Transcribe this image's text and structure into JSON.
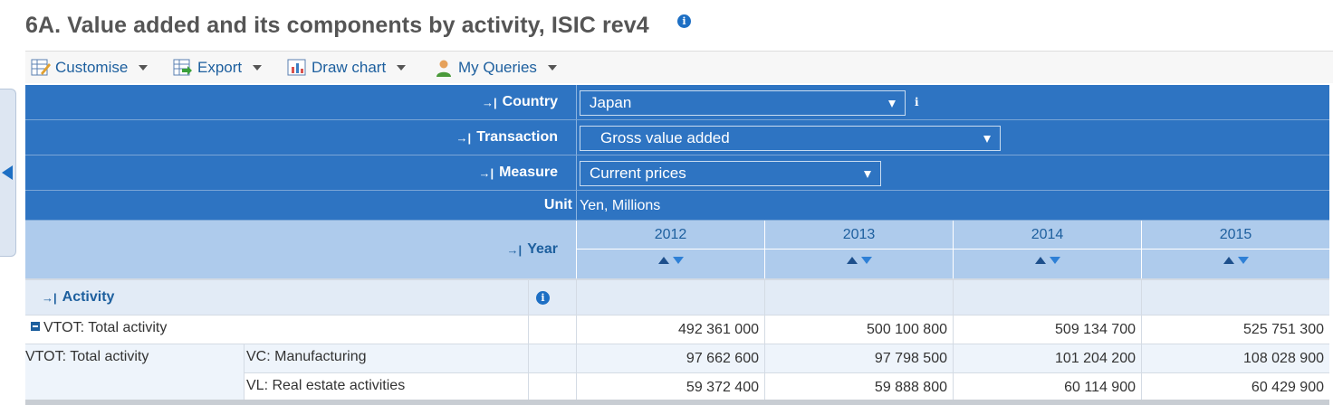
{
  "header": {
    "title": "6A. Value added and its components by activity, ISIC rev4",
    "info_icon": "info-icon"
  },
  "toolbar": {
    "items": [
      {
        "label": "Customise",
        "icon": "customise-icon"
      },
      {
        "label": "Export",
        "icon": "export-icon"
      },
      {
        "label": "Draw chart",
        "icon": "chart-icon"
      },
      {
        "label": "My Queries",
        "icon": "user-icon"
      }
    ]
  },
  "filters": {
    "country": {
      "label": "Country",
      "value": "Japan"
    },
    "transaction": {
      "label": "Transaction",
      "value": "Gross value added"
    },
    "measure": {
      "label": "Measure",
      "value": "Current prices"
    },
    "unit": {
      "label": "Unit",
      "value": "Yen, Millions"
    }
  },
  "year_header": {
    "label": "Year",
    "years": [
      "2012",
      "2013",
      "2014",
      "2015"
    ]
  },
  "activity_header": {
    "label": "Activity"
  },
  "rows": [
    {
      "group": "",
      "label": "VTOT: Total activity",
      "values": [
        "492 361 000",
        "500 100 800",
        "509 134 700",
        "525 751 300"
      ]
    },
    {
      "group": "VTOT: Total activity",
      "label": "VC: Manufacturing",
      "values": [
        "97 662 600",
        "97 798 500",
        "101 204 200",
        "108 028 900"
      ]
    },
    {
      "group": "",
      "label": "VL: Real estate activities",
      "values": [
        "59 372 400",
        "59 888 800",
        "60 114 900",
        "60 429 900"
      ]
    }
  ],
  "colors": {
    "header_blue": "#2e74c2",
    "year_row": "#aecbec",
    "link_blue": "#1d5f9e",
    "alt_row": "#eef4fb"
  }
}
